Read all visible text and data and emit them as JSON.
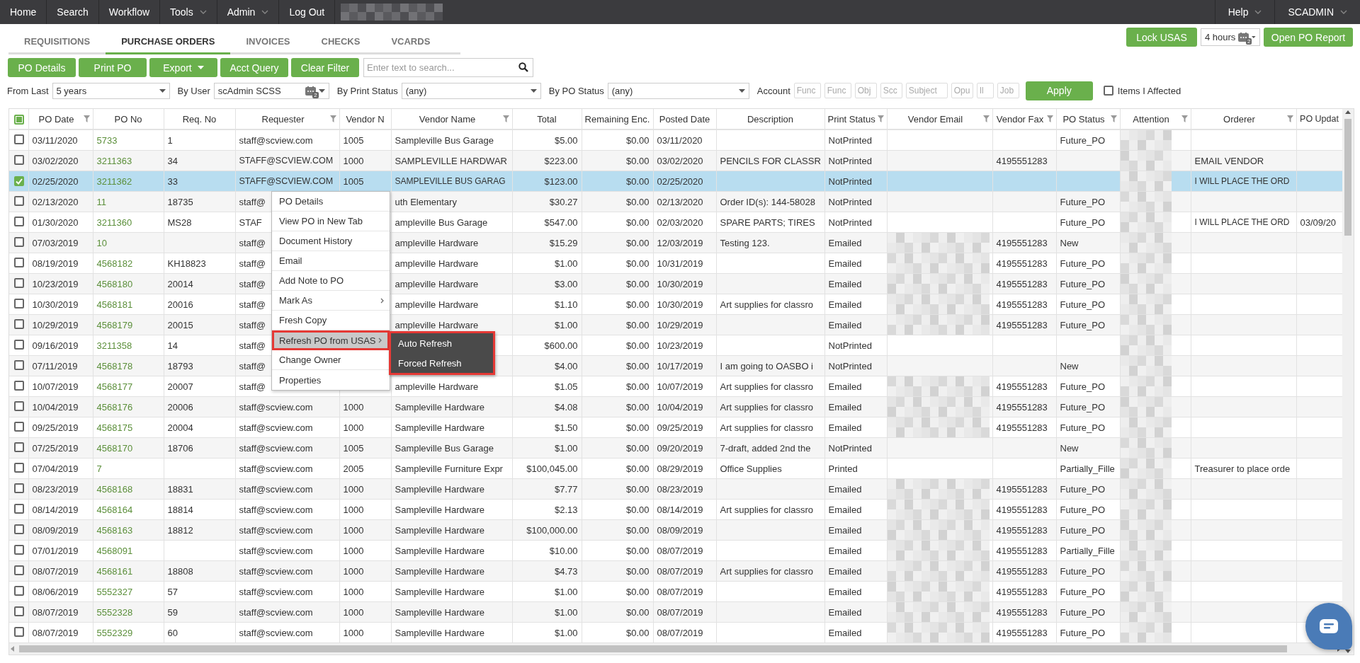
{
  "nav": {
    "items": [
      {
        "label": "Home",
        "has_menu": false
      },
      {
        "label": "Search",
        "has_menu": false
      },
      {
        "label": "Workflow",
        "has_menu": false
      },
      {
        "label": "Tools",
        "has_menu": true
      },
      {
        "label": "Admin",
        "has_menu": true
      },
      {
        "label": "Log Out",
        "has_menu": false
      }
    ],
    "redacted": true,
    "right_items": [
      {
        "label": "Help",
        "has_menu": true
      },
      {
        "label": "SCADMIN",
        "has_menu": true
      }
    ]
  },
  "tabs": [
    {
      "label": "REQUISITIONS",
      "selected": false
    },
    {
      "label": "PURCHASE ORDERS",
      "selected": true
    },
    {
      "label": "INVOICES",
      "selected": false
    },
    {
      "label": "CHECKS",
      "selected": false
    },
    {
      "label": "VCARDS",
      "selected": false
    }
  ],
  "header_actions": {
    "lock_button": "Lock USAS",
    "duration": {
      "value": "4 hours",
      "badge": "2"
    },
    "report_button": "Open PO Report"
  },
  "toolbar": {
    "buttons": [
      {
        "label": "PO Details",
        "has_menu": false
      },
      {
        "label": "Print PO",
        "has_menu": false
      },
      {
        "label": "Export",
        "has_menu": true
      },
      {
        "label": "Acct Query",
        "has_menu": false
      },
      {
        "label": "Clear Filter",
        "has_menu": false
      }
    ],
    "search": {
      "placeholder": "Enter text to search..."
    }
  },
  "filters": {
    "fields": [
      {
        "label": "From Last",
        "value": "5 years"
      },
      {
        "label": "By User",
        "value": "scAdmin SCSS",
        "badge": "2"
      },
      {
        "label": "By Print Status",
        "value": "(any)"
      },
      {
        "label": "By PO Status",
        "value": "(any)"
      }
    ],
    "account": {
      "label": "Account",
      "segments": [
        {
          "placeholder": "Func"
        },
        {
          "placeholder": "Func"
        },
        {
          "placeholder": "Obj"
        },
        {
          "placeholder": "Scc"
        },
        {
          "placeholder": "Subject"
        },
        {
          "placeholder": "Opu"
        },
        {
          "placeholder": "Il"
        },
        {
          "placeholder": "Job"
        }
      ]
    },
    "apply_button": "Apply",
    "items_affected": {
      "label": "Items I Affected",
      "checked": false
    }
  },
  "table": {
    "select_all": {
      "indeterminate": true
    },
    "columns": [
      {
        "label": "PO Date",
        "filter": true
      },
      {
        "label": "PO No",
        "filter": false
      },
      {
        "label": "Req. No",
        "filter": false
      },
      {
        "label": "Requester",
        "filter": true
      },
      {
        "label": "Vendor N",
        "filter": false
      },
      {
        "label": "Vendor Name",
        "filter": true
      },
      {
        "label": "Total",
        "filter": false
      },
      {
        "label": "Remaining Enc.",
        "filter": false
      },
      {
        "label": "Posted Date",
        "filter": false
      },
      {
        "label": "Description",
        "filter": false
      },
      {
        "label": "Print Status",
        "filter": true
      },
      {
        "label": "Vendor Email",
        "filter": true
      },
      {
        "label": "Vendor Fax",
        "filter": true
      },
      {
        "label": "PO Status",
        "filter": true
      },
      {
        "label": "Attention",
        "filter": true,
        "redacted": true
      },
      {
        "label": "Orderer",
        "filter": true
      },
      {
        "label": "PO Updat",
        "filter": false
      }
    ],
    "rows": [
      {
        "checked": false,
        "selected": false,
        "po_date": "03/11/2020",
        "po_no": "5733",
        "req_no": "1",
        "requester": "staff@scview.com",
        "vendor_no": "1005",
        "vendor_name": "Sampleville Bus Garage",
        "total": "$5.00",
        "remaining_enc": "$0.00",
        "posted_date": "03/11/2020",
        "print_status": "NotPrinted",
        "vendor_email_redacted": false,
        "po_status": "Future_PO"
      },
      {
        "checked": false,
        "selected": false,
        "po_date": "03/02/2020",
        "po_no": "3211363",
        "req_no": "34",
        "requester": "STAFF@SCVIEW.COM",
        "vendor_no": "1000",
        "vendor_name": "SAMPLEVILLE HARDWAR",
        "total": "$223.00",
        "remaining_enc": "$0.00",
        "posted_date": "03/02/2020",
        "description": "PENCILS FOR CLASSR",
        "print_status": "NotPrinted",
        "vendor_email_redacted": false,
        "vendor_fax": "4195551283",
        "orderer": "EMAIL VENDOR"
      },
      {
        "checked": true,
        "selected": true,
        "po_date": "02/25/2020",
        "po_no": "3211362",
        "req_no": "33",
        "requester": "STAFF@SCVIEW.COM",
        "vendor_no": "1005",
        "vendor_name": "SAMPLEVILLE BUS GARAG",
        "total": "$123.00",
        "remaining_enc": "$0.00",
        "posted_date": "02/25/2020",
        "print_status": "NotPrinted",
        "vendor_email_redacted": false,
        "orderer": "I WILL PLACE THE ORD"
      },
      {
        "checked": false,
        "selected": false,
        "po_date": "02/13/2020",
        "po_no": "11",
        "req_no": "18735",
        "requester": "staff@",
        "vendor_name": "uth Elementary",
        "total": "$30.27",
        "remaining_enc": "$0.00",
        "posted_date": "02/13/2020",
        "description": "Order ID(s): 144-58028",
        "print_status": "NotPrinted",
        "vendor_email_redacted": false,
        "po_status": "Future_PO"
      },
      {
        "checked": false,
        "selected": false,
        "po_date": "01/30/2020",
        "po_no": "3211360",
        "req_no": "MS28",
        "requester": "STAF",
        "vendor_name": "ampleville Bus Garage",
        "total": "$547.00",
        "remaining_enc": "$0.00",
        "posted_date": "02/03/2020",
        "description": "SPARE PARTS; TIRES",
        "print_status": "NotPrinted",
        "vendor_email_redacted": false,
        "po_status": "Future_PO",
        "orderer": "I WILL PLACE THE ORD",
        "po_updated": "03/09/20"
      },
      {
        "checked": false,
        "selected": false,
        "po_date": "07/03/2019",
        "po_no": "10",
        "requester": "staff@",
        "vendor_name": "ampleville Hardware",
        "total": "$15.29",
        "remaining_enc": "$0.00",
        "posted_date": "12/03/2019",
        "description": "Testing 123.",
        "print_status": "Emailed",
        "vendor_email_redacted": true,
        "vendor_fax": "4195551283",
        "po_status": "New"
      },
      {
        "checked": false,
        "selected": false,
        "po_date": "08/19/2019",
        "po_no": "4568182",
        "req_no": "KH18823",
        "requester": "staff@",
        "vendor_name": "ampleville Hardware",
        "total": "$1.00",
        "remaining_enc": "$0.00",
        "posted_date": "10/31/2019",
        "print_status": "Emailed",
        "vendor_email_redacted": true,
        "vendor_fax": "4195551283",
        "po_status": "Future_PO"
      },
      {
        "checked": false,
        "selected": false,
        "po_date": "10/23/2019",
        "po_no": "4568180",
        "req_no": "20014",
        "requester": "staff@",
        "vendor_name": "ampleville Hardware",
        "total": "$3.00",
        "remaining_enc": "$0.00",
        "posted_date": "10/30/2019",
        "print_status": "Emailed",
        "vendor_email_redacted": true,
        "vendor_fax": "4195551283",
        "po_status": "Future_PO"
      },
      {
        "checked": false,
        "selected": false,
        "po_date": "10/30/2019",
        "po_no": "4568181",
        "req_no": "20016",
        "requester": "staff@",
        "vendor_name": "ampleville Hardware",
        "total": "$1.10",
        "remaining_enc": "$0.00",
        "posted_date": "10/30/2019",
        "description": "Art supplies for classro",
        "print_status": "Emailed",
        "vendor_email_redacted": true,
        "vendor_fax": "4195551283",
        "po_status": "Future_PO"
      },
      {
        "checked": false,
        "selected": false,
        "po_date": "10/29/2019",
        "po_no": "4568179",
        "req_no": "20015",
        "requester": "staff@",
        "vendor_name": "ampleville Hardware",
        "total": "$1.00",
        "remaining_enc": "$0.00",
        "posted_date": "10/29/2019",
        "print_status": "Emailed",
        "vendor_email_redacted": true,
        "vendor_fax": "4195551283",
        "po_status": "Future_PO"
      },
      {
        "checked": false,
        "selected": false,
        "po_date": "09/16/2019",
        "po_no": "3211358",
        "req_no": "14",
        "requester": "staff@",
        "total": "$600.00",
        "remaining_enc": "$0.00",
        "posted_date": "10/23/2019",
        "print_status": "NotPrinted",
        "vendor_email_redacted": false
      },
      {
        "checked": false,
        "selected": false,
        "po_date": "07/11/2019",
        "po_no": "4568178",
        "req_no": "18793",
        "requester": "staff@",
        "total": "$4.00",
        "remaining_enc": "$0.00",
        "posted_date": "10/17/2019",
        "description": "I am going to OASBO i",
        "print_status": "NotPrinted",
        "vendor_email_redacted": false,
        "po_status": "New"
      },
      {
        "checked": false,
        "selected": false,
        "po_date": "10/07/2019",
        "po_no": "4568177",
        "req_no": "20007",
        "requester": "staff@",
        "vendor_name": "ampleville Hardware",
        "total": "$1.05",
        "remaining_enc": "$0.00",
        "posted_date": "10/07/2019",
        "description": "Art supplies for classro",
        "print_status": "Emailed",
        "vendor_email_redacted": true,
        "vendor_fax": "4195551283",
        "po_status": "Future_PO"
      },
      {
        "checked": false,
        "selected": false,
        "po_date": "10/04/2019",
        "po_no": "4568176",
        "req_no": "20006",
        "requester": "staff@scview.com",
        "vendor_no": "1000",
        "vendor_name": "Sampleville Hardware",
        "total": "$4.08",
        "remaining_enc": "$0.00",
        "posted_date": "10/04/2019",
        "description": "Art supplies for classro",
        "print_status": "Emailed",
        "vendor_email_redacted": true,
        "vendor_fax": "4195551283",
        "po_status": "Future_PO"
      },
      {
        "checked": false,
        "selected": false,
        "po_date": "09/25/2019",
        "po_no": "4568175",
        "req_no": "20004",
        "requester": "staff@scview.com",
        "vendor_no": "1000",
        "vendor_name": "Sampleville Hardware",
        "total": "$1.50",
        "remaining_enc": "$0.00",
        "posted_date": "09/25/2019",
        "description": "Art supplies for classro",
        "print_status": "Emailed",
        "vendor_email_redacted": true,
        "vendor_fax": "4195551283",
        "po_status": "Future_PO"
      },
      {
        "checked": false,
        "selected": false,
        "po_date": "07/25/2019",
        "po_no": "4568170",
        "req_no": "18706",
        "requester": "staff@scview.com",
        "vendor_no": "1005",
        "vendor_name": "Sampleville Bus Garage",
        "total": "$1.00",
        "remaining_enc": "$0.00",
        "posted_date": "09/20/2019",
        "description": "7-draft, added 2nd the",
        "print_status": "NotPrinted",
        "vendor_email_redacted": false,
        "po_status": "New"
      },
      {
        "checked": false,
        "selected": false,
        "po_date": "07/04/2019",
        "po_no": "7",
        "requester": "staff@scview.com",
        "vendor_no": "2005",
        "vendor_name": "Sampleville Furniture Expr",
        "total": "$100,045.00",
        "remaining_enc": "$0.00",
        "posted_date": "08/29/2019",
        "description": "Office Supplies",
        "print_status": "Printed",
        "vendor_email_redacted": false,
        "po_status": "Partially_Fille",
        "orderer": "Treasurer to place orde"
      },
      {
        "checked": false,
        "selected": false,
        "po_date": "08/23/2019",
        "po_no": "4568168",
        "req_no": "18831",
        "requester": "staff@scview.com",
        "vendor_no": "1000",
        "vendor_name": "Sampleville Hardware",
        "total": "$7.77",
        "remaining_enc": "$0.00",
        "posted_date": "08/23/2019",
        "print_status": "Emailed",
        "vendor_email_redacted": true,
        "vendor_fax": "4195551283",
        "po_status": "Future_PO"
      },
      {
        "checked": false,
        "selected": false,
        "po_date": "08/14/2019",
        "po_no": "4568164",
        "req_no": "18814",
        "requester": "staff@scview.com",
        "vendor_no": "1000",
        "vendor_name": "Sampleville Hardware",
        "total": "$2.13",
        "remaining_enc": "$0.00",
        "posted_date": "08/14/2019",
        "description": "Art supplies for classro",
        "print_status": "Emailed",
        "vendor_email_redacted": true,
        "vendor_fax": "4195551283",
        "po_status": "Future_PO"
      },
      {
        "checked": false,
        "selected": false,
        "po_date": "08/09/2019",
        "po_no": "4568163",
        "req_no": "18812",
        "requester": "staff@scview.com",
        "vendor_no": "1000",
        "vendor_name": "Sampleville Hardware",
        "total": "$100,000.00",
        "remaining_enc": "$0.00",
        "posted_date": "08/09/2019",
        "print_status": "Emailed",
        "vendor_email_redacted": true,
        "vendor_fax": "4195551283",
        "po_status": "Future_PO"
      },
      {
        "checked": false,
        "selected": false,
        "po_date": "07/01/2019",
        "po_no": "4568091",
        "requester": "staff@scview.com",
        "vendor_no": "1000",
        "vendor_name": "Sampleville Hardware",
        "total": "$10.00",
        "remaining_enc": "$0.00",
        "posted_date": "08/07/2019",
        "print_status": "Emailed",
        "vendor_email_redacted": true,
        "vendor_fax": "4195551283",
        "po_status": "Partially_Fille"
      },
      {
        "checked": false,
        "selected": false,
        "po_date": "08/07/2019",
        "po_no": "4568161",
        "req_no": "18808",
        "requester": "staff@scview.com",
        "vendor_no": "1000",
        "vendor_name": "Sampleville Hardware",
        "total": "$4.73",
        "remaining_enc": "$0.00",
        "posted_date": "08/07/2019",
        "description": "Art supplies for classro",
        "print_status": "Emailed",
        "vendor_email_redacted": true,
        "vendor_fax": "4195551283",
        "po_status": "Future_PO"
      },
      {
        "checked": false,
        "selected": false,
        "po_date": "08/06/2019",
        "po_no": "5552327",
        "req_no": "57",
        "requester": "staff@scview.com",
        "vendor_no": "1000",
        "vendor_name": "Sampleville Hardware",
        "total": "$1.00",
        "remaining_enc": "$0.00",
        "posted_date": "08/07/2019",
        "print_status": "Emailed",
        "vendor_email_redacted": true,
        "vendor_fax": "4195551283",
        "po_status": "Future_PO"
      },
      {
        "checked": false,
        "selected": false,
        "po_date": "08/07/2019",
        "po_no": "5552328",
        "req_no": "59",
        "requester": "staff@scview.com",
        "vendor_no": "1000",
        "vendor_name": "Sampleville Hardware",
        "total": "$1.00",
        "remaining_enc": "$0.00",
        "posted_date": "08/07/2019",
        "print_status": "Emailed",
        "vendor_email_redacted": true,
        "vendor_fax": "4195551283",
        "po_status": "Future_PO"
      },
      {
        "checked": false,
        "selected": false,
        "po_date": "08/07/2019",
        "po_no": "5552329",
        "req_no": "60",
        "requester": "staff@scview.com",
        "vendor_no": "1000",
        "vendor_name": "Sampleville Hardware",
        "total": "$1.00",
        "remaining_enc": "$0.00",
        "posted_date": "08/07/2019",
        "print_status": "Emailed",
        "vendor_email_redacted": true,
        "vendor_fax": "4195551283",
        "po_status": "Future_PO"
      }
    ]
  },
  "context_menu": {
    "items": [
      {
        "label": "PO Details",
        "has_submenu": false,
        "highlighted": false,
        "annotated": false
      },
      {
        "label": "View PO in New Tab",
        "has_submenu": false,
        "highlighted": false,
        "annotated": false
      },
      {
        "label": "Document History",
        "has_submenu": false,
        "highlighted": false,
        "annotated": false
      },
      {
        "label": "Email",
        "has_submenu": false,
        "highlighted": false,
        "annotated": false
      },
      {
        "label": "Add Note to PO",
        "has_submenu": false,
        "highlighted": false,
        "annotated": false
      },
      {
        "label": "Mark As",
        "has_submenu": true,
        "highlighted": false,
        "annotated": false
      },
      {
        "label": "Fresh Copy",
        "has_submenu": false,
        "highlighted": false,
        "annotated": false
      },
      {
        "label": "Refresh PO from USAS",
        "has_submenu": true,
        "highlighted": true,
        "annotated": true
      },
      {
        "label": "Change Owner",
        "has_submenu": false,
        "highlighted": false,
        "annotated": false
      },
      {
        "label": "Properties",
        "has_submenu": false,
        "highlighted": false,
        "annotated": false
      }
    ],
    "submenu": {
      "annotated": true,
      "items": [
        "Auto Refresh",
        "Forced Refresh"
      ]
    }
  }
}
